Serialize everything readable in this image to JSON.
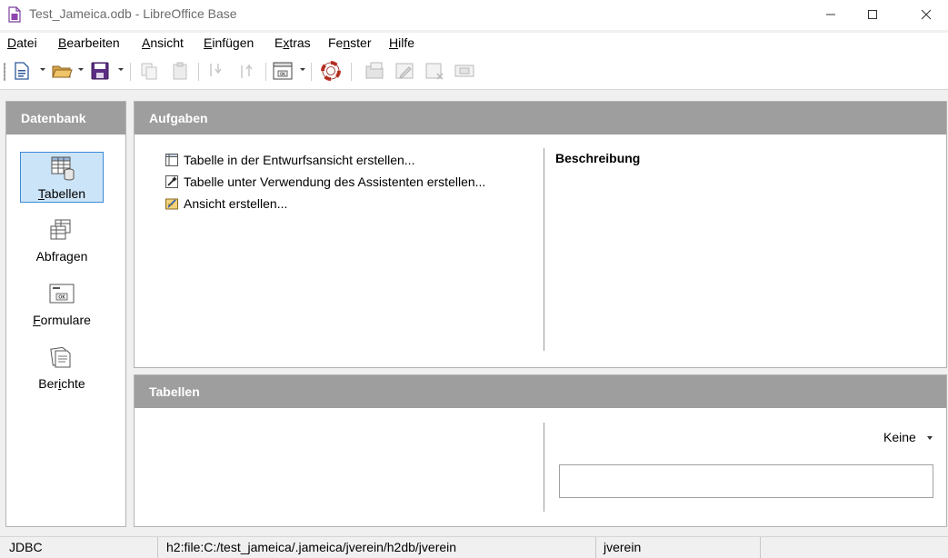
{
  "window": {
    "title": "Test_Jameica.odb - LibreOffice Base",
    "minimize_glyph": "—",
    "maximize_glyph": "☐",
    "close_glyph": "✕"
  },
  "menu": [
    {
      "label": "Datei",
      "mnemonic": "D",
      "rest": "atei"
    },
    {
      "label": "Bearbeiten",
      "mnemonic": "B",
      "rest": "earbeiten"
    },
    {
      "label": "Ansicht",
      "mnemonic": "A",
      "rest": "nsicht"
    },
    {
      "label": "Einfügen",
      "mnemonic": "E",
      "rest": "infügen"
    },
    {
      "label": "Extras",
      "mnemonic": "x",
      "pre": "E",
      "rest": "tras"
    },
    {
      "label": "Fenster",
      "mnemonic": "n",
      "pre": "Fe",
      "rest": "ster"
    },
    {
      "label": "Hilfe",
      "mnemonic": "H",
      "rest": "ilfe"
    }
  ],
  "toolbar_icons": [
    "new-document-icon",
    "open-icon",
    "save-icon",
    "copy-icon",
    "paste-icon",
    "sort-descending-icon",
    "sort-ascending-icon",
    "form-icon",
    "help-lifebuoy-icon",
    "open-database-object-icon",
    "edit-icon",
    "delete-icon",
    "rename-icon"
  ],
  "sidebar": {
    "title": "Datenbank",
    "items": [
      {
        "label": "Tabellen",
        "mnemonic": "T",
        "rest": "abellen",
        "icon": "tables-icon",
        "selected": true
      },
      {
        "label": "Abfragen",
        "pre": "Abfra",
        "mnemonic": "g",
        "rest": "en",
        "icon": "queries-icon",
        "selected": false
      },
      {
        "label": "Formulare",
        "mnemonic": "F",
        "rest": "ormulare",
        "icon": "forms-icon",
        "selected": false
      },
      {
        "label": "Berichte",
        "pre": "Ber",
        "mnemonic": "i",
        "rest": "chte",
        "icon": "reports-icon",
        "selected": false
      }
    ]
  },
  "tasks_panel": {
    "title": "Aufgaben",
    "tasks": [
      {
        "label": "Tabelle in der Entwurfsansicht erstellen...",
        "icon": "table-design-icon"
      },
      {
        "label": "Tabelle unter Verwendung des Assistenten erstellen...",
        "icon": "table-wizard-icon"
      },
      {
        "label": "Ansicht erstellen...",
        "icon": "create-view-icon"
      }
    ],
    "description_title": "Beschreibung"
  },
  "tables_panel": {
    "title": "Tabellen",
    "preview_mode": "Keine"
  },
  "statusbar": {
    "connection_type": "JDBC",
    "url": "h2:file:C:/test_jameica/.jameica/jverein/h2db/jverein",
    "user": "jverein"
  },
  "colors": {
    "header_bg": "#9e9e9e",
    "selected_bg": "#cce4f7",
    "selected_border": "#3c8ad8"
  }
}
